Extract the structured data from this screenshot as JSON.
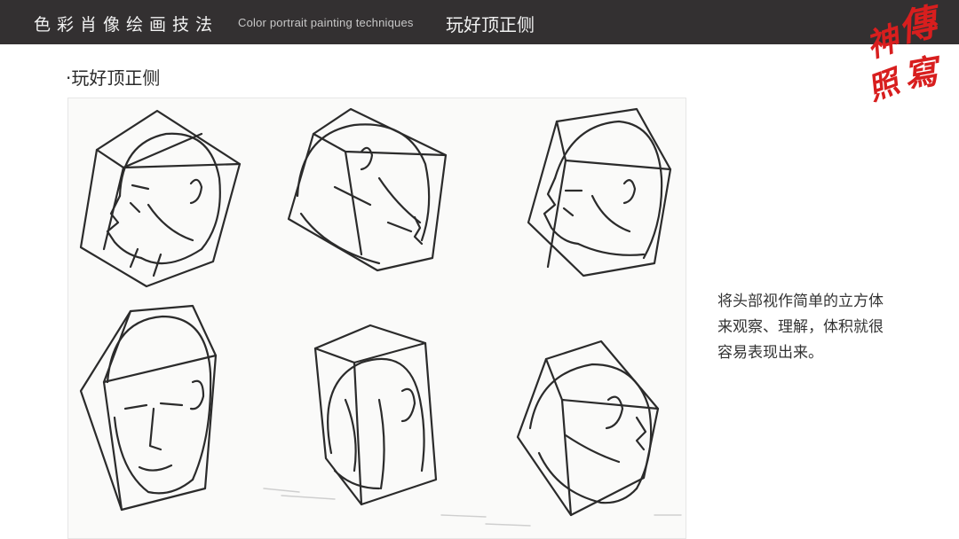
{
  "header": {
    "title_cn": "色彩肖像绘画技法",
    "title_en": "Color portrait painting techniques",
    "topic": "玩好顶正侧"
  },
  "logo": {
    "chars": [
      "傳",
      "神",
      "寫",
      "照"
    ]
  },
  "slide": {
    "subtitle": "·玩好顶正侧",
    "caption_lines": [
      "将头部视作简单的立方体",
      "来观察、理解，体积就很",
      "容易表现出来。"
    ]
  },
  "colors": {
    "header_bg": "#333031",
    "logo_red": "#d81e1e",
    "sketch_ink": "#2b2b2b"
  }
}
